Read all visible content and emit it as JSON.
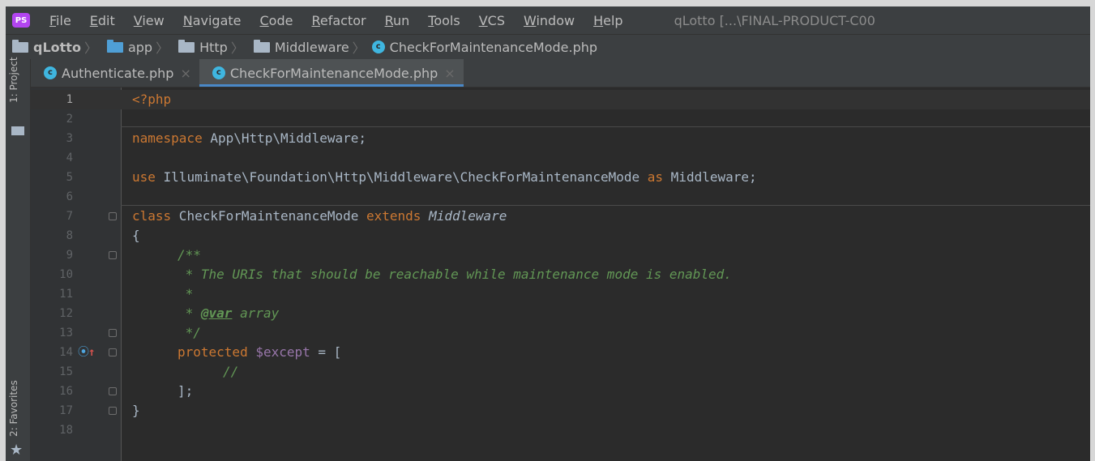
{
  "menu": {
    "app_icon": "PS",
    "items": [
      "File",
      "Edit",
      "View",
      "Navigate",
      "Code",
      "Refactor",
      "Run",
      "Tools",
      "VCS",
      "Window",
      "Help"
    ],
    "title": "qLotto [...\\FINAL-PRODUCT-C00"
  },
  "breadcrumb": [
    "qLotto",
    "app",
    "Http",
    "Middleware",
    "CheckForMaintenanceMode.php"
  ],
  "sidebar": {
    "project_label": "1: Project",
    "favorites_label": "2: Favorites"
  },
  "tabs": [
    {
      "label": "Authenticate.php",
      "active": false
    },
    {
      "label": "CheckForMaintenanceMode.php",
      "active": true
    }
  ],
  "editor": {
    "line_numbers": [
      "1",
      "2",
      "3",
      "4",
      "5",
      "6",
      "7",
      "8",
      "9",
      "10",
      "11",
      "12",
      "13",
      "14",
      "15",
      "16",
      "17",
      "18"
    ],
    "lines": {
      "l1": "<?php",
      "l3_kw": "namespace",
      "l3_rest": " App\\Http\\Middleware;",
      "l5_kw": "use",
      "l5_mid": " Illuminate\\Foundation\\Http\\Middleware\\CheckForMaintenanceMode ",
      "l5_as": "as",
      "l5_end": " Middleware;",
      "l7_kw": "class",
      "l7_name": " CheckForMaintenanceMode ",
      "l7_ext": "extends",
      "l7_parent": "Middleware",
      "l8": "{",
      "l9": "/**",
      "l10": " * The URIs that should be reachable while maintenance mode is enabled.",
      "l11": " *",
      "l12_pre": " * ",
      "l12_tag": "@var",
      "l12_post": " array",
      "l13": " */",
      "l14_kw": "protected",
      "l14_var": "$except",
      "l14_rest": " = [",
      "l15": "//",
      "l16": "];",
      "l17": "}"
    }
  }
}
